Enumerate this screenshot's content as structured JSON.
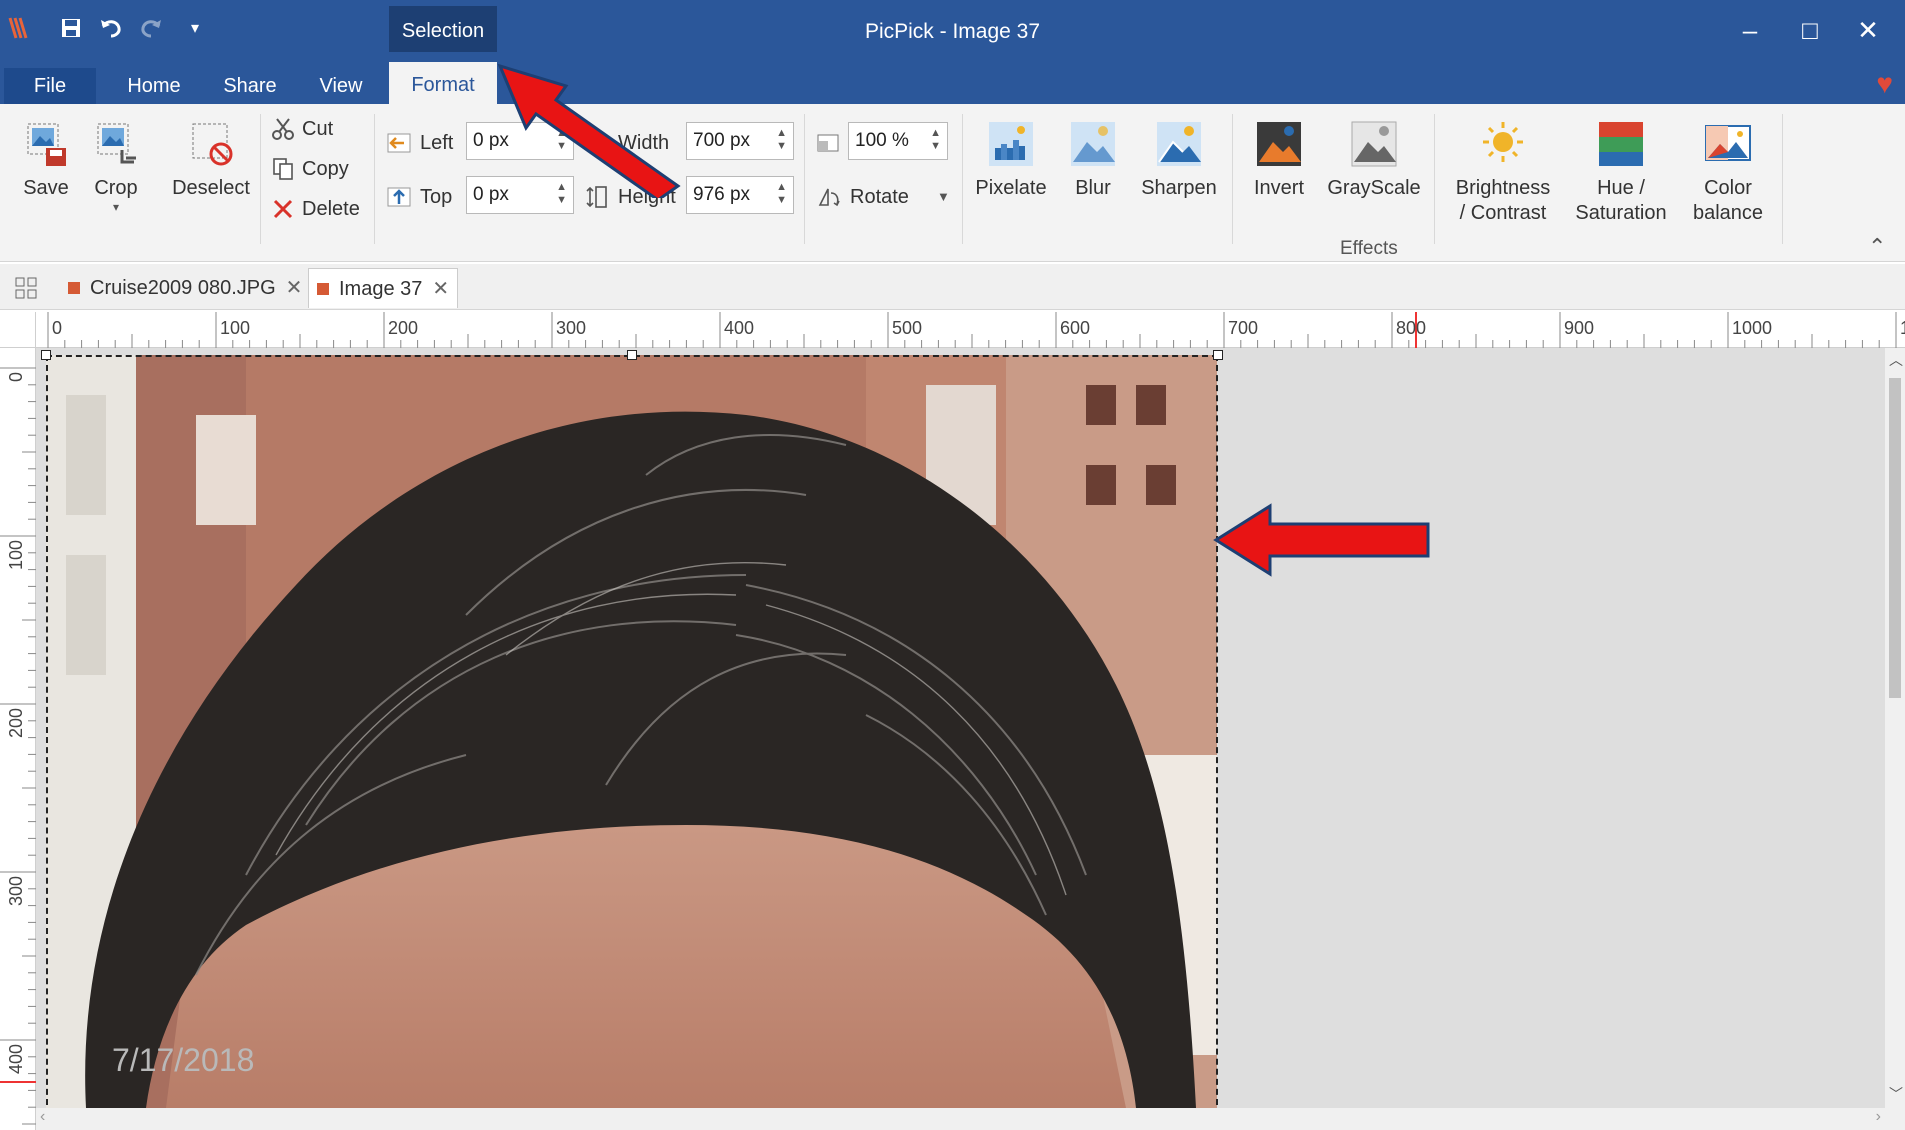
{
  "app": {
    "title": "PicPick - Image 37",
    "context_group": "Selection"
  },
  "quick_access": {
    "icons": [
      "logo-icon",
      "save-icon",
      "undo-icon",
      "redo-icon",
      "customize-icon"
    ]
  },
  "window_controls": {
    "minimize": "–",
    "maximize": "□",
    "close": "✕"
  },
  "tabs": [
    "File",
    "Home",
    "Share",
    "View",
    "Format"
  ],
  "active_tab": "Format",
  "ribbon": {
    "save": "Save",
    "crop": "Crop",
    "deselect": "Deselect",
    "cut": "Cut",
    "copy": "Copy",
    "delete": "Delete",
    "left_label": "Left",
    "left_value": "0 px",
    "top_label": "Top",
    "top_value": "0 px",
    "width_label": "Width",
    "width_value": "700 px",
    "height_label": "Height",
    "height_value": "976 px",
    "zoom_value": "100 %",
    "rotate": "Rotate",
    "effects": {
      "pixelate": "Pixelate",
      "blur": "Blur",
      "sharpen": "Sharpen",
      "invert": "Invert",
      "grayscale": "GrayScale",
      "brightness_1": "Brightness",
      "brightness_2": "/ Contrast",
      "hue_1": "Hue /",
      "hue_2": "Saturation",
      "color_1": "Color",
      "color_2": "balance"
    },
    "group_effects": "Effects"
  },
  "doc_tabs": [
    {
      "label": "Cruise2009 080.JPG",
      "active": false
    },
    {
      "label": "Image 37",
      "active": true
    }
  ],
  "ruler": {
    "h_labels": [
      "0",
      "100",
      "200",
      "300",
      "400",
      "500",
      "600",
      "700",
      "800",
      "900",
      "1000",
      "1"
    ],
    "v_labels": [
      "0",
      "100",
      "200",
      "300",
      "400"
    ]
  },
  "photo": {
    "date_stamp": "7/17/2018"
  },
  "colors": {
    "titlebar": "#2b579a",
    "context_group": "#1d3f73",
    "ribbon_bg": "#f3f3f3",
    "canvas_bg": "#dedede",
    "annotation_arrow": "#e81414"
  }
}
